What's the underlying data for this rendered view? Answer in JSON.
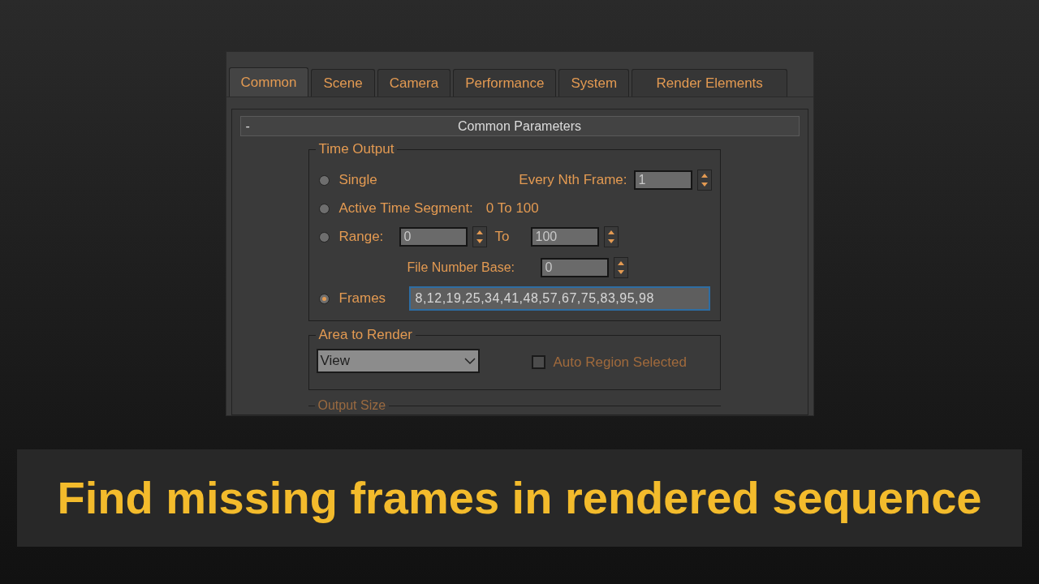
{
  "tabs": [
    {
      "label": "Common",
      "selected": true
    },
    {
      "label": "Scene",
      "selected": false
    },
    {
      "label": "Camera",
      "selected": false
    },
    {
      "label": "Performance",
      "selected": false
    },
    {
      "label": "System",
      "selected": false
    },
    {
      "label": "Render Elements",
      "selected": false
    }
  ],
  "rollout": {
    "toggle": "-",
    "title": "Common Parameters"
  },
  "time_output": {
    "title": "Time Output",
    "single": {
      "label": "Single",
      "selected": false
    },
    "every_nth": {
      "label": "Every Nth Frame:",
      "value": "1"
    },
    "active_segment": {
      "label": "Active Time Segment:",
      "selected": false,
      "value": "0 To 100"
    },
    "range": {
      "label": "Range:",
      "selected": false,
      "from": "0",
      "to_label": "To",
      "to": "100"
    },
    "file_number_base": {
      "label": "File Number Base:",
      "value": "0"
    },
    "frames": {
      "label": "Frames",
      "selected": true,
      "value": "8,12,19,25,34,41,48,57,67,75,83,95,98"
    }
  },
  "area_to_render": {
    "title": "Area to Render",
    "dropdown": "View",
    "auto_region": {
      "label": "Auto Region Selected",
      "checked": false,
      "disabled": true
    }
  },
  "output_size": {
    "title": "Output Size"
  },
  "caption": "Find missing frames in rendered sequence"
}
